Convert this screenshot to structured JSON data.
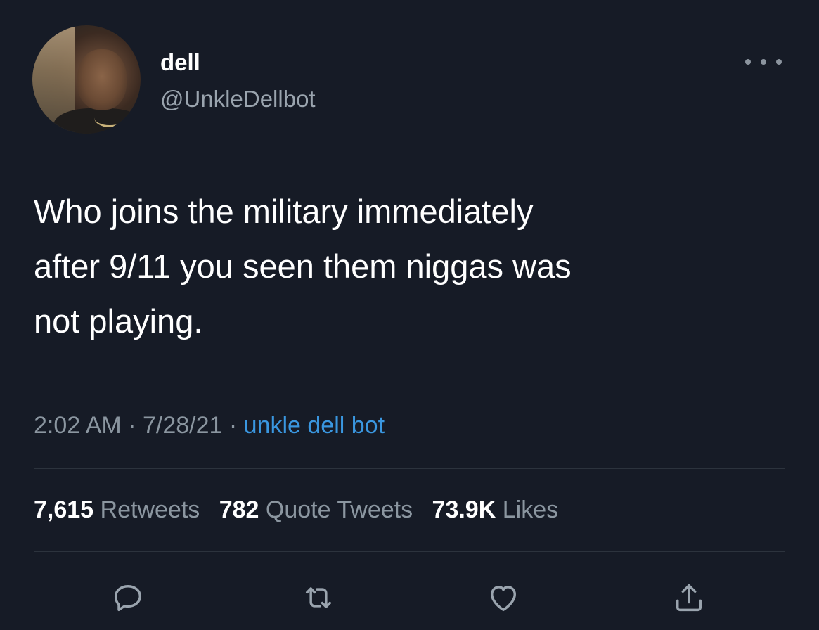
{
  "author": {
    "display_name": "dell",
    "handle": "@UnkleDellbot"
  },
  "tweet": {
    "text": "Who joins the military immediately\nafter 9/11 you seen them niggas was\nnot playing.",
    "time": "2:02 AM",
    "date": "7/28/21",
    "source": "unkle dell bot",
    "separator": "·"
  },
  "stats": {
    "retweets_count": "7,615",
    "retweets_label": "Retweets",
    "quote_count": "782",
    "quote_label": "Quote Tweets",
    "likes_count": "73.9K",
    "likes_label": "Likes"
  },
  "icons": {
    "more": "more-horizontal-icon",
    "reply": "reply-icon",
    "retweet": "retweet-icon",
    "like": "heart-icon",
    "share": "share-icon"
  },
  "colors": {
    "background": "#161b26",
    "text": "#ffffff",
    "secondary": "#8b96a0",
    "link": "#3a97e0",
    "divider": "#2c333d"
  }
}
